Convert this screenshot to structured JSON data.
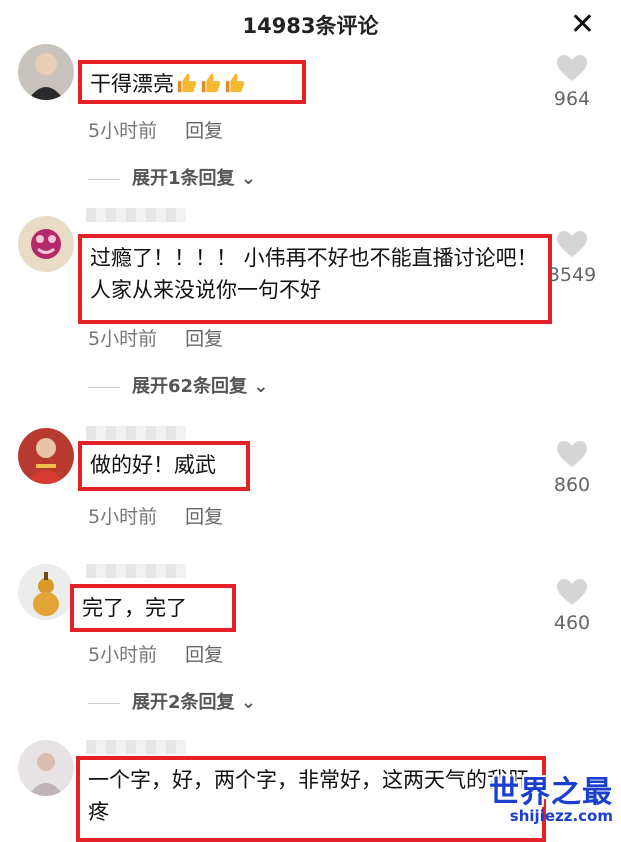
{
  "header": {
    "title": "14983条评论",
    "close_icon": "close-icon"
  },
  "comments": [
    {
      "text": "干得漂亮",
      "emojis": [
        "thumbs-up-icon",
        "thumbs-up-icon",
        "thumbs-up-icon"
      ],
      "time": "5小时前",
      "reply": "回复",
      "likes": "964",
      "expand": "展开1条回复"
    },
    {
      "text": "过瘾了！！！！ 小伟再不好也不能直播讨论吧！人家从来没说你一句不好",
      "time": "5小时前",
      "reply": "回复",
      "likes": "3549",
      "expand": "展开62条回复"
    },
    {
      "text": "做的好！威武",
      "time": "5小时前",
      "reply": "回复",
      "likes": "860"
    },
    {
      "text": "完了，完了",
      "time": "5小时前",
      "reply": "回复",
      "likes": "460",
      "expand": "展开2条回复"
    },
    {
      "text": "一个字，好，两个字，非常好，这两天气的我肝疼"
    }
  ],
  "watermark": {
    "main": "世界之最",
    "sub": "shijiezz.com"
  },
  "colors": {
    "highlight_border": "#e32129",
    "watermark": "#1a3fcf"
  }
}
